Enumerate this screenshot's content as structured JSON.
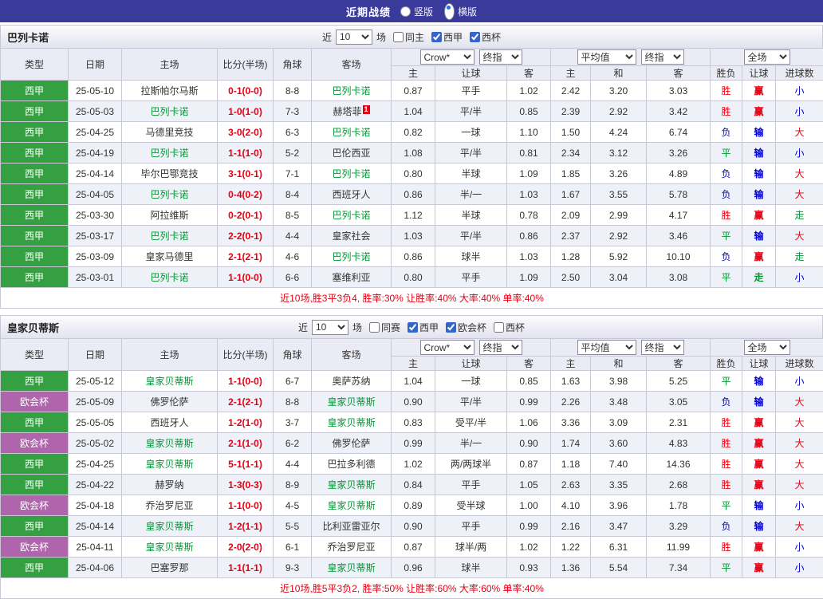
{
  "topbar": {
    "title": "近期战绩",
    "options": [
      {
        "label": "竖版",
        "selected": false
      },
      {
        "label": "横版",
        "selected": true
      }
    ]
  },
  "colors": {
    "topbar_bg": "#3a3a9a",
    "league": {
      "西甲": "#35a042",
      "欧会杯": "#b064ac"
    },
    "outcome": {
      "胜": "#e60012",
      "平": "#009933",
      "负": "#0000cc",
      "赢": "#e60012",
      "走": "#009933",
      "输": "#0000cc",
      "大": "#e60012",
      "小": "#0000cc"
    },
    "focus_team": "#009933",
    "score": "#e60012",
    "footer_text": "#e60012"
  },
  "table_header": {
    "type": "类型",
    "date": "日期",
    "home": "主场",
    "score": "比分(半场)",
    "corner": "角球",
    "away": "客场",
    "odds_group": {
      "select1": "Crow*",
      "select2": "终指",
      "cols": [
        "主",
        "让球",
        "客"
      ]
    },
    "avg_group": {
      "select1": "平均值",
      "select2": "终指",
      "cols": [
        "主",
        "和",
        "客"
      ]
    },
    "full_group": {
      "select1": "全场",
      "cols": [
        "胜负",
        "让球",
        "进球数"
      ]
    }
  },
  "sections": [
    {
      "team": "巴列卡诺",
      "filter": {
        "prefix": "近",
        "count": "10",
        "suffix": "场",
        "checkboxes": [
          {
            "label": "同主",
            "checked": false
          },
          {
            "label": "西甲",
            "checked": true
          },
          {
            "label": "西杯",
            "checked": true
          }
        ]
      },
      "rows": [
        {
          "league": "西甲",
          "date": "25-05-10",
          "home": "拉斯帕尔马斯",
          "home_focus": false,
          "score": "0-1(0-0)",
          "corner": "8-8",
          "away": "巴列卡诺",
          "away_focus": true,
          "o_home": "0.87",
          "o_hcap": "平手",
          "o_away": "1.02",
          "a_home": "2.42",
          "a_draw": "3.20",
          "a_away": "3.03",
          "res": "胜",
          "hres": "赢",
          "goals": "小"
        },
        {
          "league": "西甲",
          "date": "25-05-03",
          "home": "巴列卡诺",
          "home_focus": true,
          "score": "1-0(1-0)",
          "corner": "7-3",
          "away": "赫塔菲",
          "away_focus": false,
          "away_badge": "1",
          "o_home": "1.04",
          "o_hcap": "平/半",
          "o_away": "0.85",
          "a_home": "2.39",
          "a_draw": "2.92",
          "a_away": "3.42",
          "res": "胜",
          "hres": "赢",
          "goals": "小"
        },
        {
          "league": "西甲",
          "date": "25-04-25",
          "home": "马德里竞技",
          "home_focus": false,
          "score": "3-0(2-0)",
          "corner": "6-3",
          "away": "巴列卡诺",
          "away_focus": true,
          "o_home": "0.82",
          "o_hcap": "一球",
          "o_away": "1.10",
          "a_home": "1.50",
          "a_draw": "4.24",
          "a_away": "6.74",
          "res": "负",
          "hres": "输",
          "goals": "大"
        },
        {
          "league": "西甲",
          "date": "25-04-19",
          "home": "巴列卡诺",
          "home_focus": true,
          "score": "1-1(1-0)",
          "corner": "5-2",
          "away": "巴伦西亚",
          "away_focus": false,
          "o_home": "1.08",
          "o_hcap": "平/半",
          "o_away": "0.81",
          "a_home": "2.34",
          "a_draw": "3.12",
          "a_away": "3.26",
          "res": "平",
          "hres": "输",
          "goals": "小"
        },
        {
          "league": "西甲",
          "date": "25-04-14",
          "home": "毕尔巴鄂竞技",
          "home_focus": false,
          "score": "3-1(0-1)",
          "corner": "7-1",
          "away": "巴列卡诺",
          "away_focus": true,
          "o_home": "0.80",
          "o_hcap": "半球",
          "o_away": "1.09",
          "a_home": "1.85",
          "a_draw": "3.26",
          "a_away": "4.89",
          "res": "负",
          "hres": "输",
          "goals": "大"
        },
        {
          "league": "西甲",
          "date": "25-04-05",
          "home": "巴列卡诺",
          "home_focus": true,
          "score": "0-4(0-2)",
          "corner": "8-4",
          "away": "西班牙人",
          "away_focus": false,
          "o_home": "0.86",
          "o_hcap": "半/一",
          "o_away": "1.03",
          "a_home": "1.67",
          "a_draw": "3.55",
          "a_away": "5.78",
          "res": "负",
          "hres": "输",
          "goals": "大"
        },
        {
          "league": "西甲",
          "date": "25-03-30",
          "home": "阿拉维斯",
          "home_focus": false,
          "score": "0-2(0-1)",
          "corner": "8-5",
          "away": "巴列卡诺",
          "away_focus": true,
          "o_home": "1.12",
          "o_hcap": "半球",
          "o_away": "0.78",
          "a_home": "2.09",
          "a_draw": "2.99",
          "a_away": "4.17",
          "res": "胜",
          "hres": "赢",
          "goals": "走"
        },
        {
          "league": "西甲",
          "date": "25-03-17",
          "home": "巴列卡诺",
          "home_focus": true,
          "score": "2-2(0-1)",
          "corner": "4-4",
          "away": "皇家社会",
          "away_focus": false,
          "o_home": "1.03",
          "o_hcap": "平/半",
          "o_away": "0.86",
          "a_home": "2.37",
          "a_draw": "2.92",
          "a_away": "3.46",
          "res": "平",
          "hres": "输",
          "goals": "大"
        },
        {
          "league": "西甲",
          "date": "25-03-09",
          "home": "皇家马德里",
          "home_focus": false,
          "score": "2-1(2-1)",
          "corner": "4-6",
          "away": "巴列卡诺",
          "away_focus": true,
          "o_home": "0.86",
          "o_hcap": "球半",
          "o_away": "1.03",
          "a_home": "1.28",
          "a_draw": "5.92",
          "a_away": "10.10",
          "res": "负",
          "hres": "赢",
          "goals": "走"
        },
        {
          "league": "西甲",
          "date": "25-03-01",
          "home": "巴列卡诺",
          "home_focus": true,
          "score": "1-1(0-0)",
          "corner": "6-6",
          "away": "塞维利亚",
          "away_focus": false,
          "o_home": "0.80",
          "o_hcap": "平手",
          "o_away": "1.09",
          "a_home": "2.50",
          "a_draw": "3.04",
          "a_away": "3.08",
          "res": "平",
          "hres": "走",
          "goals": "小"
        }
      ],
      "footer": "近10场,胜3平3负4, 胜率:30% 让胜率:40% 大率:40% 单率:40%"
    },
    {
      "team": "皇家贝蒂斯",
      "filter": {
        "prefix": "近",
        "count": "10",
        "suffix": "场",
        "checkboxes": [
          {
            "label": "同赛",
            "checked": false
          },
          {
            "label": "西甲",
            "checked": true
          },
          {
            "label": "欧会杯",
            "checked": true
          },
          {
            "label": "西杯",
            "checked": false
          }
        ]
      },
      "rows": [
        {
          "league": "西甲",
          "date": "25-05-12",
          "home": "皇家贝蒂斯",
          "home_focus": true,
          "score": "1-1(0-0)",
          "corner": "6-7",
          "away": "奥萨苏纳",
          "away_focus": false,
          "o_home": "1.04",
          "o_hcap": "一球",
          "o_away": "0.85",
          "a_home": "1.63",
          "a_draw": "3.98",
          "a_away": "5.25",
          "res": "平",
          "hres": "输",
          "goals": "小"
        },
        {
          "league": "欧会杯",
          "date": "25-05-09",
          "home": "佛罗伦萨",
          "home_focus": false,
          "score": "2-1(2-1)",
          "corner": "8-8",
          "away": "皇家贝蒂斯",
          "away_focus": true,
          "o_home": "0.90",
          "o_hcap": "平/半",
          "o_away": "0.99",
          "a_home": "2.26",
          "a_draw": "3.48",
          "a_away": "3.05",
          "res": "负",
          "hres": "输",
          "goals": "大"
        },
        {
          "league": "西甲",
          "date": "25-05-05",
          "home": "西班牙人",
          "home_focus": false,
          "score": "1-2(1-0)",
          "corner": "3-7",
          "away": "皇家贝蒂斯",
          "away_focus": true,
          "o_home": "0.83",
          "o_hcap": "受平/半",
          "o_away": "1.06",
          "a_home": "3.36",
          "a_draw": "3.09",
          "a_away": "2.31",
          "res": "胜",
          "hres": "赢",
          "goals": "大"
        },
        {
          "league": "欧会杯",
          "date": "25-05-02",
          "home": "皇家贝蒂斯",
          "home_focus": true,
          "score": "2-1(1-0)",
          "corner": "6-2",
          "away": "佛罗伦萨",
          "away_focus": false,
          "o_home": "0.99",
          "o_hcap": "半/一",
          "o_away": "0.90",
          "a_home": "1.74",
          "a_draw": "3.60",
          "a_away": "4.83",
          "res": "胜",
          "hres": "赢",
          "goals": "大"
        },
        {
          "league": "西甲",
          "date": "25-04-25",
          "home": "皇家贝蒂斯",
          "home_focus": true,
          "score": "5-1(1-1)",
          "corner": "4-4",
          "away": "巴拉多利德",
          "away_focus": false,
          "o_home": "1.02",
          "o_hcap": "两/两球半",
          "o_away": "0.87",
          "a_home": "1.18",
          "a_draw": "7.40",
          "a_away": "14.36",
          "res": "胜",
          "hres": "赢",
          "goals": "大"
        },
        {
          "league": "西甲",
          "date": "25-04-22",
          "home": "赫罗纳",
          "home_focus": false,
          "score": "1-3(0-3)",
          "corner": "8-9",
          "away": "皇家贝蒂斯",
          "away_focus": true,
          "o_home": "0.84",
          "o_hcap": "平手",
          "o_away": "1.05",
          "a_home": "2.63",
          "a_draw": "3.35",
          "a_away": "2.68",
          "res": "胜",
          "hres": "赢",
          "goals": "大"
        },
        {
          "league": "欧会杯",
          "date": "25-04-18",
          "home": "乔治罗尼亚",
          "home_focus": false,
          "score": "1-1(0-0)",
          "corner": "4-5",
          "away": "皇家贝蒂斯",
          "away_focus": true,
          "o_home": "0.89",
          "o_hcap": "受半球",
          "o_away": "1.00",
          "a_home": "4.10",
          "a_draw": "3.96",
          "a_away": "1.78",
          "res": "平",
          "hres": "输",
          "goals": "小"
        },
        {
          "league": "西甲",
          "date": "25-04-14",
          "home": "皇家贝蒂斯",
          "home_focus": true,
          "score": "1-2(1-1)",
          "corner": "5-5",
          "away": "比利亚雷亚尔",
          "away_focus": false,
          "o_home": "0.90",
          "o_hcap": "平手",
          "o_away": "0.99",
          "a_home": "2.16",
          "a_draw": "3.47",
          "a_away": "3.29",
          "res": "负",
          "hres": "输",
          "goals": "大"
        },
        {
          "league": "欧会杯",
          "date": "25-04-11",
          "home": "皇家贝蒂斯",
          "home_focus": true,
          "score": "2-0(2-0)",
          "corner": "6-1",
          "away": "乔治罗尼亚",
          "away_focus": false,
          "o_home": "0.87",
          "o_hcap": "球半/两",
          "o_away": "1.02",
          "a_home": "1.22",
          "a_draw": "6.31",
          "a_away": "11.99",
          "res": "胜",
          "hres": "赢",
          "goals": "小"
        },
        {
          "league": "西甲",
          "date": "25-04-06",
          "home": "巴塞罗那",
          "home_focus": false,
          "score": "1-1(1-1)",
          "corner": "9-3",
          "away": "皇家贝蒂斯",
          "away_focus": true,
          "o_home": "0.96",
          "o_hcap": "球半",
          "o_away": "0.93",
          "a_home": "1.36",
          "a_draw": "5.54",
          "a_away": "7.34",
          "res": "平",
          "hres": "赢",
          "goals": "小"
        }
      ],
      "footer": "近10场,胜5平3负2, 胜率:50% 让胜率:60% 大率:60% 单率:40%"
    }
  ]
}
